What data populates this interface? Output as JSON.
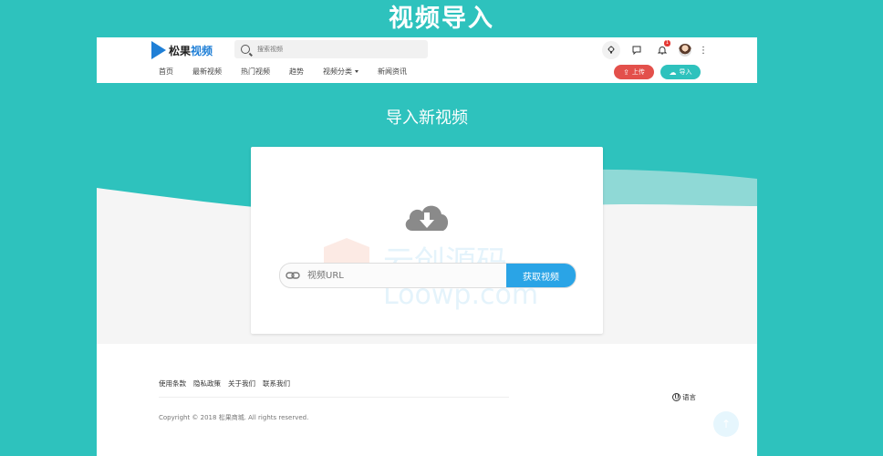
{
  "banner": {
    "title": "视频导入"
  },
  "header": {
    "logo": {
      "text_black": "松果",
      "text_blue": "视频"
    },
    "search": {
      "placeholder": "搜索视频"
    },
    "icons": [
      "bulb-icon",
      "chat-icon",
      "bell-icon",
      "avatar",
      "more-icon"
    ],
    "notification_count": "1"
  },
  "nav": {
    "items": [
      "首页",
      "最新视频",
      "热门视频",
      "趋势",
      "视频分类",
      "新闻资讯"
    ],
    "upload_label": "上传",
    "import_label": "导入"
  },
  "main": {
    "title": "导入新视频",
    "url_placeholder": "视频URL",
    "fetch_label": "获取视频"
  },
  "watermark": {
    "line1": "云创源码",
    "line2": "Loowp.com"
  },
  "footer": {
    "links": [
      "使用条款",
      "隐私政策",
      "关于我们",
      "联系我们"
    ],
    "language_label": "语言",
    "copyright": "Copyright © 2018 松果商城. All rights reserved."
  },
  "colors": {
    "brand": "#2ec2bd",
    "upload": "#e3504b",
    "fetch": "#2aa4e6",
    "logo_blue": "#1f7fd6"
  }
}
